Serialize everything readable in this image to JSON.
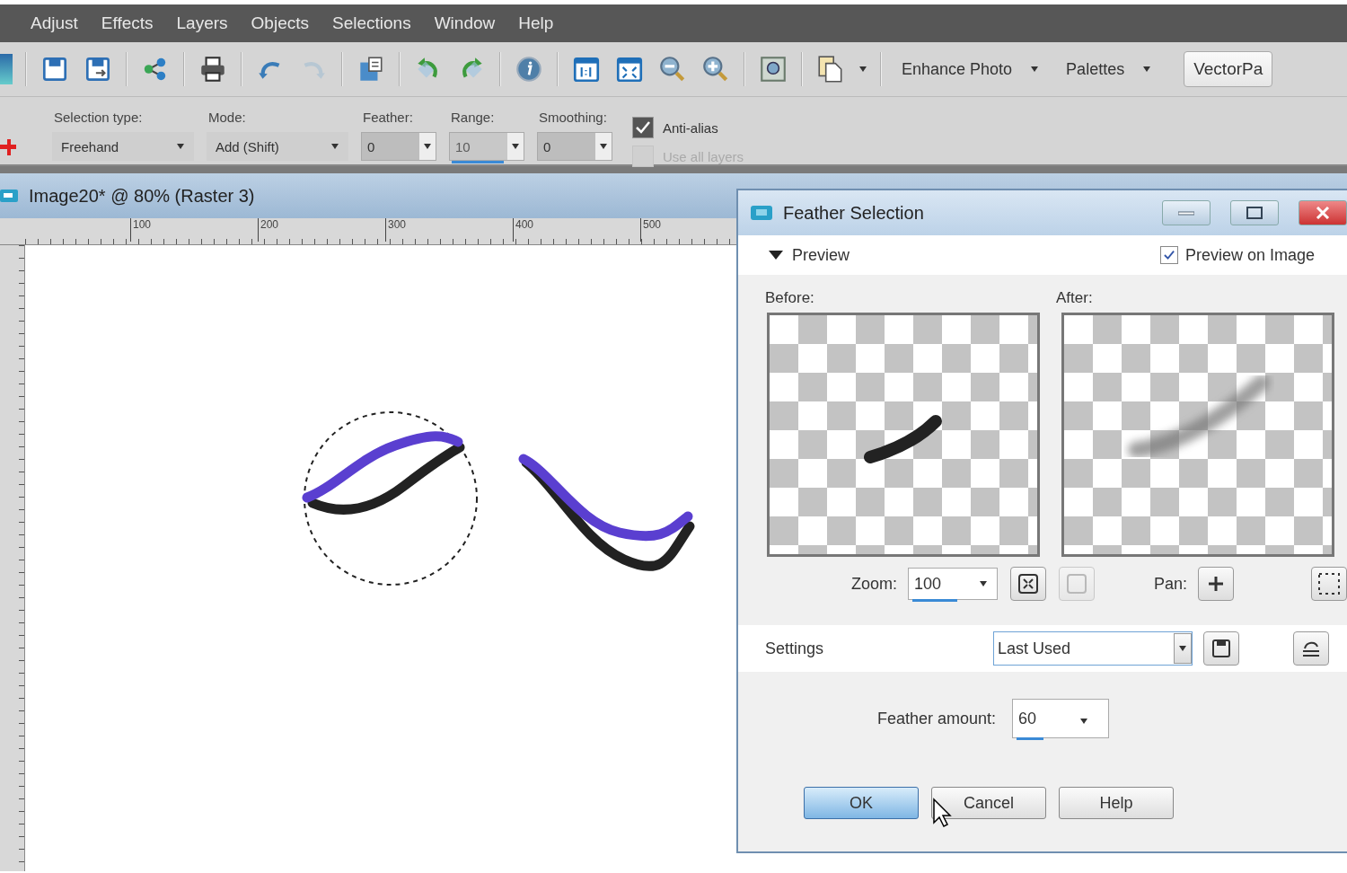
{
  "menu": [
    "Adjust",
    "Effects",
    "Layers",
    "Objects",
    "Selections",
    "Window",
    "Help"
  ],
  "toolbar": {
    "dropdowns": [
      "Enhance Photo",
      "Palettes"
    ],
    "button": "VectorPa"
  },
  "tool_options": {
    "fields": [
      {
        "label": "Selection type:",
        "value": "Freehand",
        "kind": "dropdown",
        "disabled": false
      },
      {
        "label": "Mode:",
        "value": "Add (Shift)",
        "kind": "dropdown",
        "disabled": false
      },
      {
        "label": "Feather:",
        "value": "0",
        "kind": "spinner",
        "disabled": false
      },
      {
        "label": "Range:",
        "value": "10",
        "kind": "spinner",
        "disabled": true
      },
      {
        "label": "Smoothing:",
        "value": "0",
        "kind": "spinner",
        "disabled": false
      }
    ],
    "checkboxes": [
      {
        "label": "Anti-alias",
        "checked": true,
        "disabled": false
      },
      {
        "label": "Use all layers",
        "checked": false,
        "disabled": true
      }
    ]
  },
  "image_window": {
    "title": "Image20* @ 80% (Raster 3)",
    "ruler_labels": [
      "100",
      "200",
      "300",
      "400",
      "500"
    ]
  },
  "dialog": {
    "title": "Feather Selection",
    "preview": {
      "label": "Preview",
      "expanded": true
    },
    "preview_on_image": {
      "label": "Preview on Image",
      "checked": true
    },
    "before_label": "Before:",
    "after_label": "After:",
    "zoom": {
      "label": "Zoom:",
      "value": "100"
    },
    "pan_label": "Pan:",
    "settings": {
      "label": "Settings",
      "value": "Last Used"
    },
    "feather_amount": {
      "label": "Feather amount:",
      "value": "60"
    },
    "buttons": [
      {
        "label": "OK",
        "default": true
      },
      {
        "label": "Cancel",
        "default": false
      },
      {
        "label": "Help",
        "default": false
      }
    ]
  }
}
